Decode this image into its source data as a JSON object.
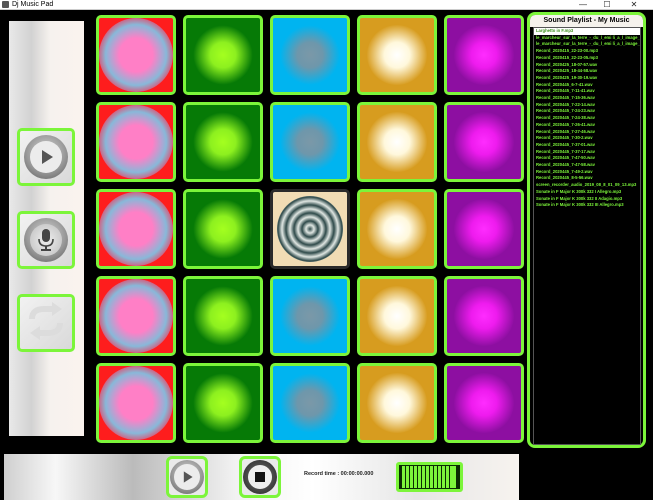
{
  "window": {
    "title": "Dj Music Pad",
    "minimize": "—",
    "maximize": "☐",
    "close": "✕"
  },
  "sidebar": {
    "buttons": [
      {
        "name": "play-icon"
      },
      {
        "name": "microphone-icon"
      },
      {
        "name": "repeat-icon"
      }
    ]
  },
  "pads": {
    "columns": [
      {
        "color": "#fe1d1d",
        "glow": "pink"
      },
      {
        "color": "#067a06",
        "glow": "lime"
      },
      {
        "color": "#00b4f0",
        "glow": "grey"
      },
      {
        "color": "#d79c1f",
        "glow": "white"
      },
      {
        "color": "#8d0fa1",
        "glow": "magenta"
      }
    ],
    "active_pad": {
      "row": 2,
      "column": 2
    },
    "active_color": "#f1dcb4"
  },
  "playlist": {
    "title": "Sound Playlist - My Music",
    "items": [
      "Larghetto in F.mp3",
      "le_marcheur_sur_la_terre_-_du_l_emi li_a_l_image_1_Voice",
      "le_marcheur_sur_la_terre_-_du_l_emi li_a_l_image_2_Voice",
      "Record_2020415_22-23-00.mp3",
      "Record_2020415_22-23-05.mp3",
      "Record_2020425_18-07-57.wav",
      "Record_2020425_18-44-58.wav",
      "Record_2020425_19-30-19.wav",
      "Record_2020445_6-7-41.wav",
      "Record_2020445_7-11-41.wav",
      "Record_2020445_7-15-36.wav",
      "Record_2020445_7-22-14.wav",
      "Record_2020445_7-24-23.wav",
      "Record_2020445_7-24-38.wav",
      "Record_2020445_7-26-41.wav",
      "Record_2020445_7-27-46.wav",
      "Record_2020445_7-30-2.wav",
      "Record_2020445_7-37-01.wav",
      "Record_2020445_7-37-17.wav",
      "Record_2020445_7-47-50.wav",
      "Record_2020445_7-47-58.wav",
      "Record_2020445_7-49-2.wav",
      "Record_2020445_8-5-56.wav",
      "screen_recorder_audio_2019_08_8_01_09_13.mp3",
      "Sonate in F Major K 300k 332 I Allegro.mp3",
      "Sonate in F Major K 300k 332 II Adagio.mp3",
      "Sonate in F Major K 300k 332 III Allegro.mp3"
    ],
    "selected_index": 0
  },
  "bottom": {
    "record_time": "Record time : 00:00:00.000",
    "play_icon": "play-icon",
    "stop_icon": "stop-icon",
    "level_icon": "level-meter"
  },
  "colors": {
    "accent": "#7cf53a",
    "background": "#000000"
  }
}
